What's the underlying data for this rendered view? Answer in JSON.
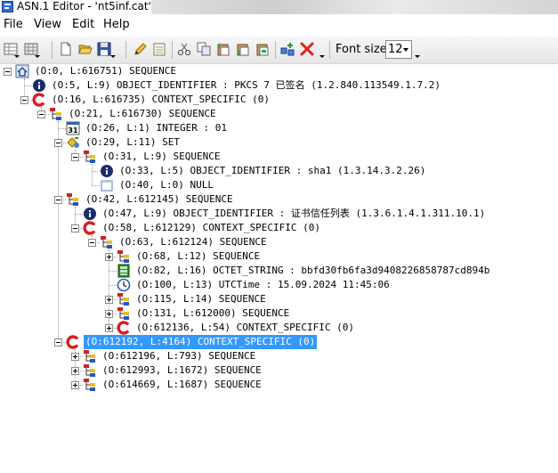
{
  "window": {
    "title": "ASN.1 Editor - 'nt5inf.cat'"
  },
  "menu": {
    "items": [
      "File",
      "View",
      "Edit",
      "Help"
    ]
  },
  "toolbar": {
    "font_size_label": "Font size:",
    "font_size_value": "12"
  },
  "tree": {
    "nodes": [
      {
        "depth": 0,
        "expander": "minus",
        "icon": "home",
        "text": "(O:0, L:616751) SEQUENCE"
      },
      {
        "depth": 1,
        "expander": "none",
        "icon": "info",
        "text": "(O:5, L:9) OBJECT_IDENTIFIER : PKCS 7 已签名 (1.2.840.113549.1.7.2)"
      },
      {
        "depth": 1,
        "expander": "minus",
        "icon": "context",
        "text": "(O:16, L:616735) CONTEXT_SPECIFIC (0)"
      },
      {
        "depth": 2,
        "expander": "minus",
        "icon": "sequence",
        "text": "(O:21, L:616730) SEQUENCE"
      },
      {
        "depth": 3,
        "expander": "none",
        "icon": "integer",
        "text": "(O:26, L:1) INTEGER : 01"
      },
      {
        "depth": 3,
        "expander": "minus",
        "icon": "set",
        "text": "(O:29, L:11) SET"
      },
      {
        "depth": 4,
        "expander": "minus",
        "icon": "sequence",
        "text": "(O:31, L:9) SEQUENCE"
      },
      {
        "depth": 5,
        "expander": "none",
        "icon": "info",
        "text": "(O:33, L:5) OBJECT_IDENTIFIER : sha1 (1.3.14.3.2.26)"
      },
      {
        "depth": 5,
        "expander": "none",
        "icon": "null",
        "text": "(O:40, L:0) NULL"
      },
      {
        "depth": 3,
        "expander": "minus",
        "icon": "sequence",
        "text": "(O:42, L:612145) SEQUENCE"
      },
      {
        "depth": 4,
        "expander": "none",
        "icon": "info",
        "text": "(O:47, L:9) OBJECT_IDENTIFIER : 证书信任列表 (1.3.6.1.4.1.311.10.1)"
      },
      {
        "depth": 4,
        "expander": "minus",
        "icon": "context",
        "text": "(O:58, L:612129) CONTEXT_SPECIFIC (0)"
      },
      {
        "depth": 5,
        "expander": "minus",
        "icon": "sequence",
        "text": "(O:63, L:612124) SEQUENCE"
      },
      {
        "depth": 6,
        "expander": "plus",
        "icon": "sequence",
        "text": "(O:68, L:12) SEQUENCE"
      },
      {
        "depth": 6,
        "expander": "none",
        "icon": "octet",
        "text": "(O:82, L:16) OCTET_STRING : bbfd30fb6fa3d9408226858787cd894b"
      },
      {
        "depth": 6,
        "expander": "none",
        "icon": "clock",
        "text": "(O:100, L:13) UTCTime : 15.09.2024 11:45:06"
      },
      {
        "depth": 6,
        "expander": "plus",
        "icon": "sequence",
        "text": "(O:115, L:14) SEQUENCE"
      },
      {
        "depth": 6,
        "expander": "plus",
        "icon": "sequence",
        "text": "(O:131, L:612000) SEQUENCE"
      },
      {
        "depth": 6,
        "expander": "plus",
        "icon": "context",
        "text": "(O:612136, L:54) CONTEXT_SPECIFIC (0)"
      },
      {
        "depth": 3,
        "expander": "minus",
        "icon": "context",
        "text": "(O:612192, L:4164) CONTEXT_SPECIFIC (0)",
        "selected": true
      },
      {
        "depth": 4,
        "expander": "plus",
        "icon": "sequence",
        "text": "(O:612196, L:793) SEQUENCE"
      },
      {
        "depth": 4,
        "expander": "plus",
        "icon": "sequence",
        "text": "(O:612993, L:1672) SEQUENCE"
      },
      {
        "depth": 4,
        "expander": "plus",
        "icon": "sequence",
        "text": "(O:614669, L:1687) SEQUENCE"
      }
    ]
  },
  "colors": {
    "selection": "#3399ff",
    "context_icon": "#d81e1e",
    "info_icon": "#1a2b6e",
    "sequence_icon_red": "#cc2222",
    "sequence_icon_yellow": "#e8c020",
    "sequence_icon_blue": "#2255cc"
  }
}
